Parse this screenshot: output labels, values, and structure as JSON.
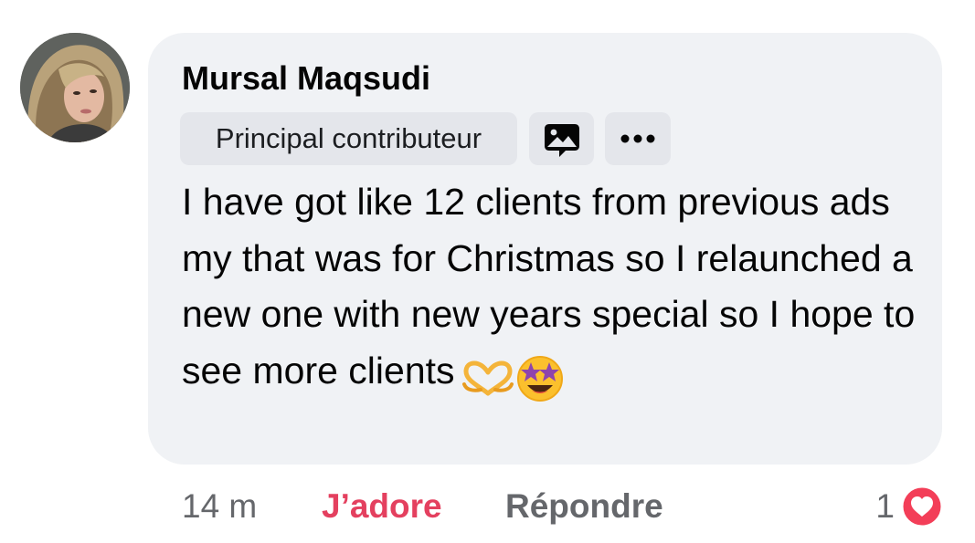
{
  "comment": {
    "author": "Mursal Maqsudi",
    "badge": "Principal contributeur",
    "text": "I have got like 12 clients from previous ads my that was for Christmas so I relaunched a new one with new years special so I hope to see more clients",
    "emojis": [
      "heart-hands-emoji",
      "star-struck-emoji"
    ],
    "icons": [
      "image-comment-icon",
      "more-options-icon"
    ]
  },
  "actions": {
    "time": "14 m",
    "love": "J’adore",
    "reply": "Répondre",
    "reaction_count": "1",
    "reaction_icon": "love-reaction-icon"
  },
  "colors": {
    "bubble": "#f0f2f5",
    "chip": "#e4e6eb",
    "love": "#e4405f",
    "muted": "#65676b"
  }
}
